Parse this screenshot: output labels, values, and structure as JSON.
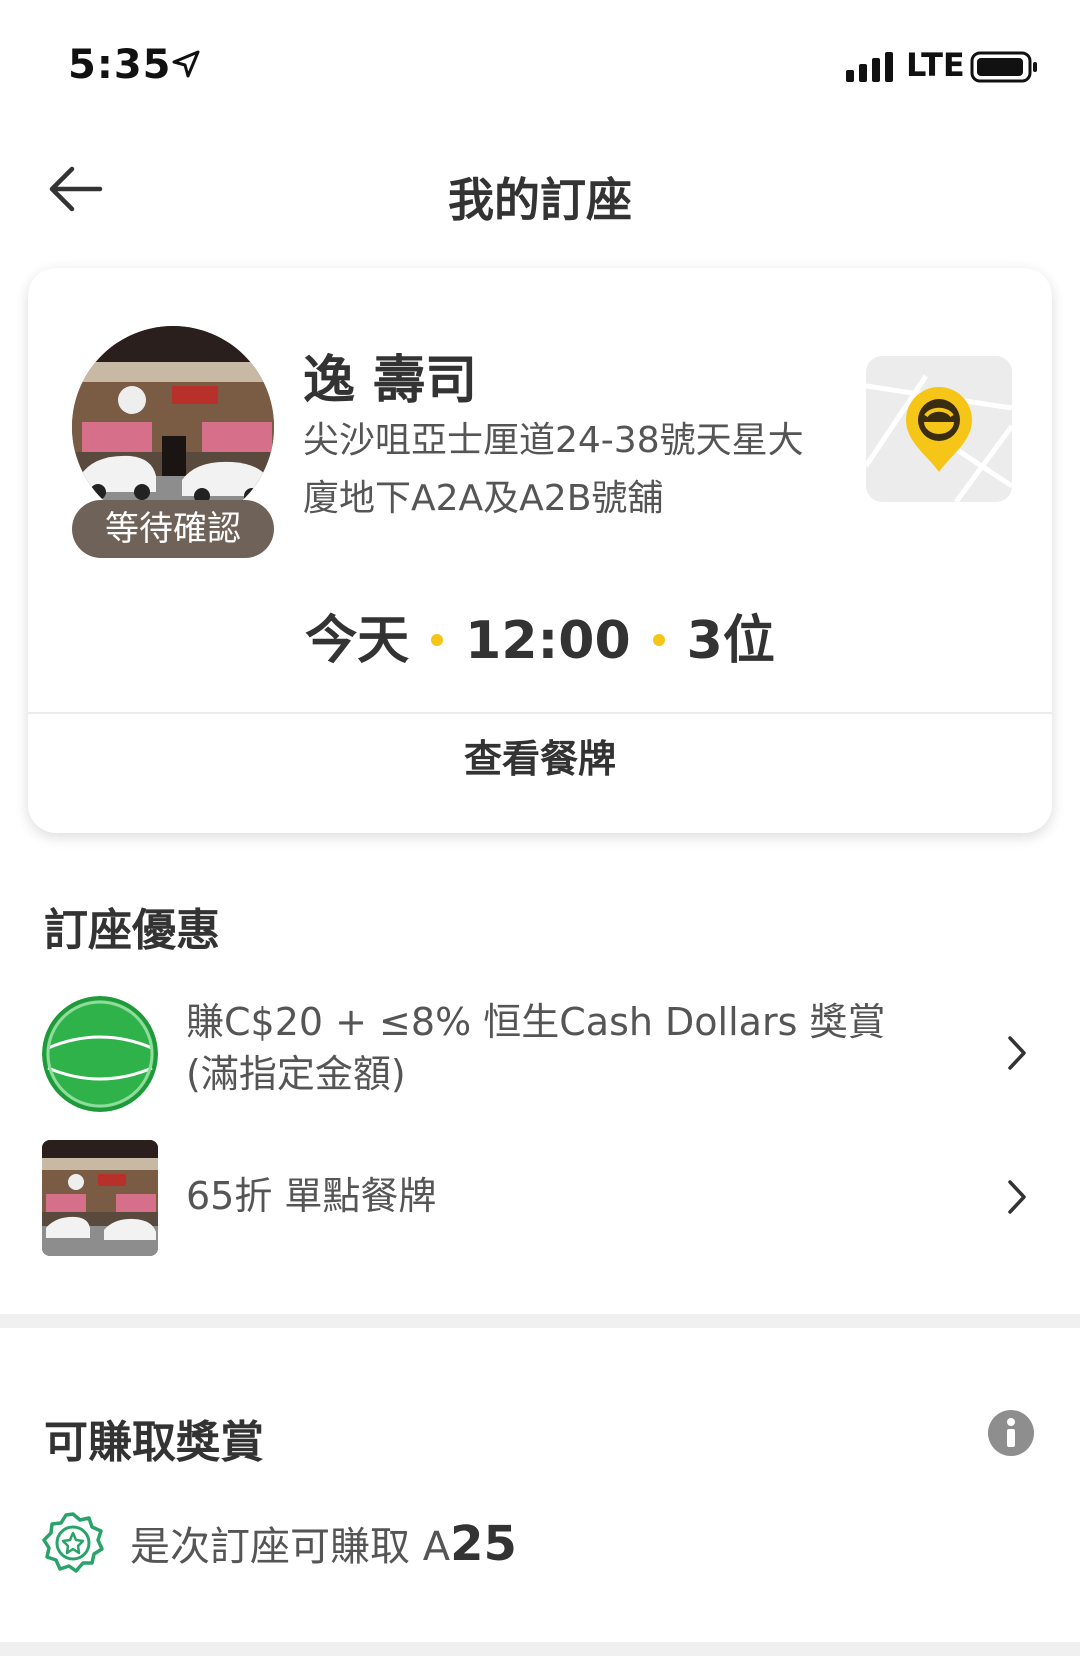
{
  "status_bar": {
    "time": "5:35",
    "network": "LTE"
  },
  "header": {
    "title": "我的訂座"
  },
  "booking": {
    "restaurant_name": "逸 壽司",
    "address": "尖沙咀亞士厘道24-38號天星大廈地下A2A及A2B號舖",
    "status": "等待確認",
    "date": "今天",
    "time": "12:00",
    "party": "3位",
    "menu_link": "查看餐牌",
    "accent_color": "#f5c518"
  },
  "offers": {
    "title": "訂座優惠",
    "items": [
      {
        "text_line1": "賺C$20 + ≤8% 恒生Cash Dollars 獎賞",
        "text_line2": "(滿指定金額)",
        "icon": "cash-dollars-logo"
      },
      {
        "text_line1": "65折 單點餐牌",
        "icon": "restaurant-photo"
      }
    ]
  },
  "rewards": {
    "title": "可賺取獎賞",
    "text": "是次訂座可賺取",
    "currency_symbol": "A",
    "amount": "25"
  }
}
